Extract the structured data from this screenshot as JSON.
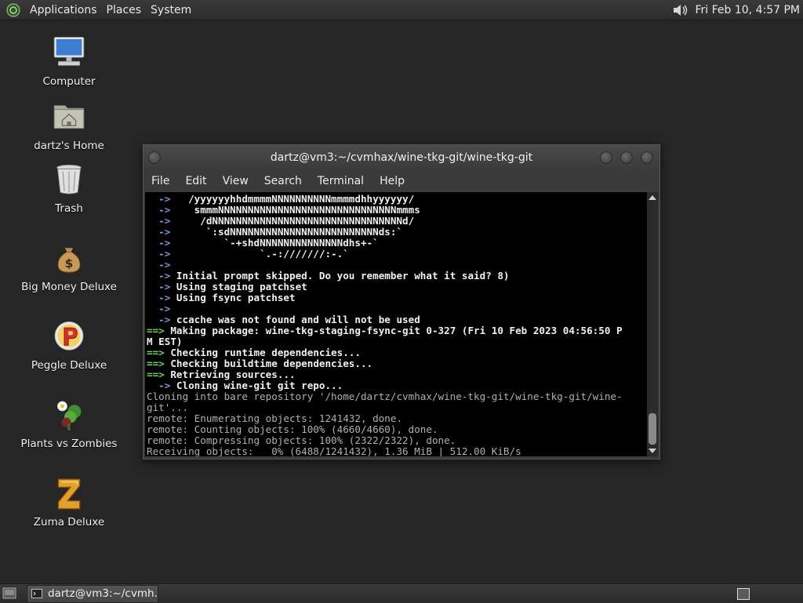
{
  "top_panel": {
    "menus": [
      "Applications",
      "Places",
      "System"
    ],
    "clock": "Fri Feb 10,  4:57 PM",
    "icons": [
      "gnome-foot-icon",
      "volume-icon"
    ]
  },
  "desktop_icons": [
    {
      "label": "Computer",
      "icon": "computer-icon"
    },
    {
      "label": "dartz's Home",
      "icon": "home-folder-icon"
    },
    {
      "label": "Trash",
      "icon": "trash-icon"
    },
    {
      "label": "Big Money Deluxe",
      "icon": "money-bag-icon"
    },
    {
      "label": "Peggle Deluxe",
      "icon": "peggle-icon"
    },
    {
      "label": "Plants vs Zombies",
      "icon": "plants-icon"
    },
    {
      "label": "Zuma Deluxe",
      "icon": "zuma-icon"
    }
  ],
  "terminal": {
    "title": "dartz@vm3:~/cvmhax/wine-tkg-git/wine-tkg-git",
    "menus": [
      "File",
      "Edit",
      "View",
      "Search",
      "Terminal",
      "Help"
    ],
    "lines": [
      {
        "parts": [
          {
            "t": "  ->  ",
            "c": "arr"
          },
          {
            "t": " /yyyyyyhhdmmmmNNNNNNNNNNmmmmdhhyyyyyy/",
            "c": "b"
          }
        ]
      },
      {
        "parts": [
          {
            "t": "  ->  ",
            "c": "arr"
          },
          {
            "t": "  smmmNNNNNNNNNNNNNNNNNNNNNNNNNNNNNNmmms",
            "c": "b"
          }
        ]
      },
      {
        "parts": [
          {
            "t": "  ->  ",
            "c": "arr"
          },
          {
            "t": "   /dNNNNNNNNNNNNNNNNNNNNNNNNNNNNNNNNd/",
            "c": "b"
          }
        ]
      },
      {
        "parts": [
          {
            "t": "  ->  ",
            "c": "arr"
          },
          {
            "t": "    `:sdNNNNNNNNNNNNNNNNNNNNNNNNNds:`",
            "c": "b"
          }
        ]
      },
      {
        "parts": [
          {
            "t": "  ->  ",
            "c": "arr"
          },
          {
            "t": "       `-+shdNNNNNNNNNNNNNNdhs+-`",
            "c": "b"
          }
        ]
      },
      {
        "parts": [
          {
            "t": "  ->  ",
            "c": "arr"
          },
          {
            "t": "             `.-:///////:-.`",
            "c": "b"
          }
        ]
      },
      {
        "parts": [
          {
            "t": "  ->",
            "c": "arr"
          }
        ]
      },
      {
        "parts": [
          {
            "t": "  -> ",
            "c": "arr"
          },
          {
            "t": "Initial prompt skipped. Do you remember what it said? 8)",
            "c": "b"
          }
        ]
      },
      {
        "parts": [
          {
            "t": "  -> ",
            "c": "arr"
          },
          {
            "t": "Using staging patchset",
            "c": "b"
          }
        ]
      },
      {
        "parts": [
          {
            "t": "  -> ",
            "c": "arr"
          },
          {
            "t": "Using fsync patchset",
            "c": "b"
          }
        ]
      },
      {
        "parts": [
          {
            "t": "  ->",
            "c": "arr"
          }
        ]
      },
      {
        "parts": [
          {
            "t": "  -> ",
            "c": "arr"
          },
          {
            "t": "ccache was not found and will not be used",
            "c": "b"
          }
        ]
      },
      {
        "parts": [
          {
            "t": "==> ",
            "c": "grn"
          },
          {
            "t": "Making package: wine-tkg-staging-fsync-git 0-327 (Fri 10 Feb 2023 04:56:50 P",
            "c": "b"
          }
        ]
      },
      {
        "parts": [
          {
            "t": "M EST)",
            "c": "b"
          }
        ]
      },
      {
        "parts": [
          {
            "t": "==> ",
            "c": "grn"
          },
          {
            "t": "Checking runtime dependencies...",
            "c": "b"
          }
        ]
      },
      {
        "parts": [
          {
            "t": "==> ",
            "c": "grn"
          },
          {
            "t": "Checking buildtime dependencies...",
            "c": "b"
          }
        ]
      },
      {
        "parts": [
          {
            "t": "==> ",
            "c": "grn"
          },
          {
            "t": "Retrieving sources...",
            "c": "b"
          }
        ]
      },
      {
        "parts": [
          {
            "t": "  -> ",
            "c": "arr"
          },
          {
            "t": "Cloning wine-git git repo...",
            "c": "b"
          }
        ]
      },
      {
        "parts": [
          {
            "t": "Cloning into bare repository '/home/dartz/cvmhax/wine-tkg-git/wine-tkg-git/wine-",
            "c": "dim"
          }
        ]
      },
      {
        "parts": [
          {
            "t": "git'...",
            "c": "dim"
          }
        ]
      },
      {
        "parts": [
          {
            "t": "remote: Enumerating objects: 1241432, done.",
            "c": "dim"
          }
        ]
      },
      {
        "parts": [
          {
            "t": "remote: Counting objects: 100% (4660/4660), done.",
            "c": "dim"
          }
        ]
      },
      {
        "parts": [
          {
            "t": "remote: Compressing objects: 100% (2322/2322), done.",
            "c": "dim"
          }
        ]
      },
      {
        "parts": [
          {
            "t": "Receiving objects:   0% (6488/1241432), 1.36 MiB | 512.00 KiB/s",
            "c": "dim"
          }
        ]
      }
    ]
  },
  "taskbar": {
    "task_label": "dartz@vm3:~/cvmh...",
    "icons": [
      "show-desktop-icon",
      "terminal-icon",
      "workspace-switcher-icon"
    ]
  }
}
